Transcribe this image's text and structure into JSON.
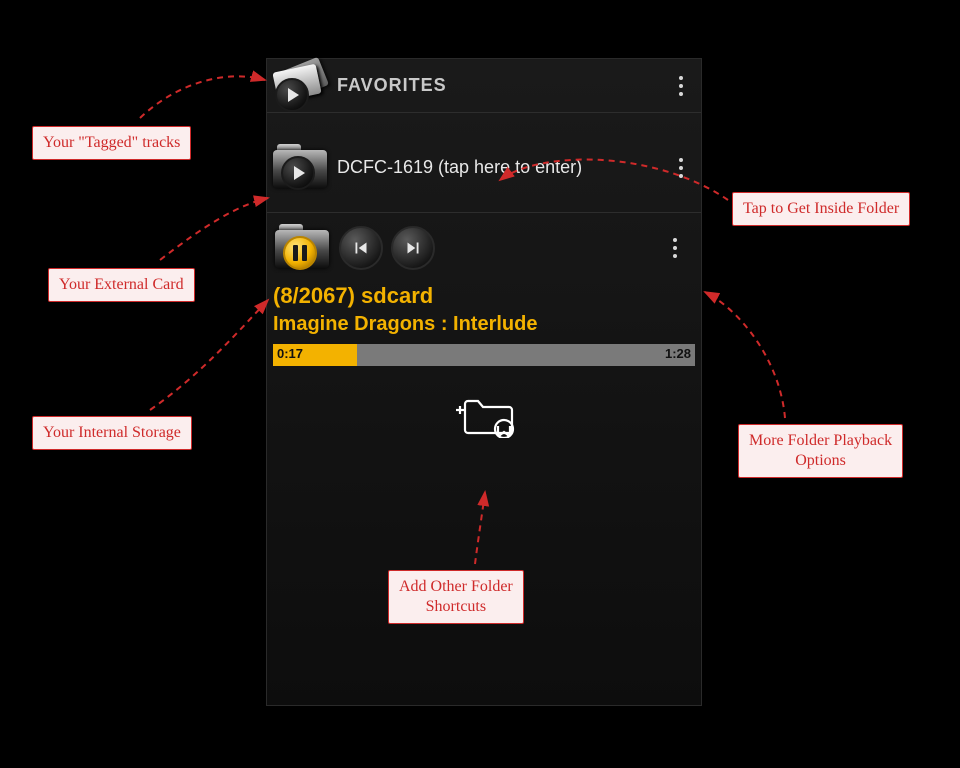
{
  "header": {
    "title": "FAVORITES"
  },
  "folder": {
    "title": "DCFC-1619 (tap here to enter)"
  },
  "nowplaying": {
    "counter": "(8/2067)  sdcard",
    "track": "Imagine Dragons : Interlude",
    "elapsed": "0:17",
    "duration": "1:28",
    "progress_pct": 20
  },
  "callouts": {
    "tagged": "Your \"Tagged\" tracks",
    "external": "Your External Card",
    "internal": "Your Internal Storage",
    "inside": "Tap to Get Inside Folder",
    "moreopts": "More Folder Playback\nOptions",
    "addshort": "Add Other Folder\nShortcuts"
  },
  "colors": {
    "accent": "#f3b200",
    "annotation": "#cf2a2a"
  }
}
